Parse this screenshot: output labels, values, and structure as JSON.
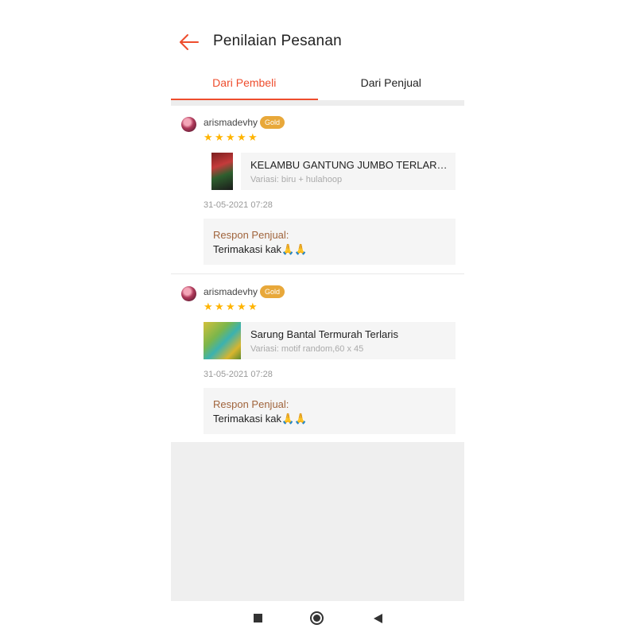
{
  "header": {
    "back_icon": "arrow-left-icon",
    "title": "Penilaian Pesanan"
  },
  "tabs": [
    {
      "label": "Dari Pembeli",
      "active": true
    },
    {
      "label": "Dari Penjual",
      "active": false
    }
  ],
  "colors": {
    "accent": "#ee4d2d",
    "gold_badge": "#e8a83a",
    "star": "#ffb400",
    "response_label": "#a0643c"
  },
  "reviews": [
    {
      "username": "arismadevhy",
      "badge": "Gold",
      "rating": 5,
      "product_name": "KELAMBU GANTUNG JUMBO TERLARIS...",
      "variant": "Variasi: biru + hulahoop",
      "date": "31-05-2021 07:28",
      "response_label": "Respon Penjual:",
      "response_text": "Terimakasi kak🙏🙏"
    },
    {
      "username": "arismadevhy",
      "badge": "Gold",
      "rating": 5,
      "product_name": "Sarung Bantal Termurah Terlaris",
      "variant": "Variasi: motif random,60 x 45",
      "date": "31-05-2021 07:28",
      "response_label": "Respon Penjual:",
      "response_text": "Terimakasi kak🙏🙏"
    }
  ],
  "nav_bar": {
    "recents_icon": "square-icon",
    "home_icon": "home-circle-icon",
    "back_icon": "back-triangle-icon"
  }
}
